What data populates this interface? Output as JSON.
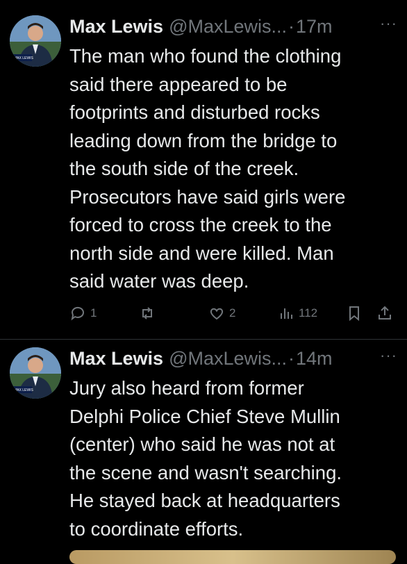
{
  "tweets": [
    {
      "avatar_label": "MAX LEWIS",
      "name": "Max Lewis",
      "handle": "@MaxLewis...",
      "dot": "·",
      "time": "17m",
      "more": "···",
      "text": "The man who found the clothing\nsaid there appeared to be\nfootprints and disturbed rocks\nleading down from the bridge to\nthe south side of the creek.\nProsecutors have said girls were\nforced to cross the creek to the\nnorth side and were killed. Man\nsaid water was deep.",
      "replies": "1",
      "retweets": "",
      "likes": "2",
      "views": "112"
    },
    {
      "avatar_label": "MAX LEWIS",
      "name": "Max Lewis",
      "handle": "@MaxLewis...",
      "dot": "·",
      "time": "14m",
      "more": "···",
      "text": "Jury also heard from former\nDelphi Police Chief Steve Mullin\n(center) who said he was not at\nthe scene and wasn't searching.\nHe stayed back at headquarters\nto coordinate efforts."
    }
  ],
  "icons": {
    "reply": "reply-icon",
    "retweet": "retweet-icon",
    "like": "heart-icon",
    "views": "views-icon",
    "bookmark": "bookmark-icon",
    "share": "share-icon"
  }
}
